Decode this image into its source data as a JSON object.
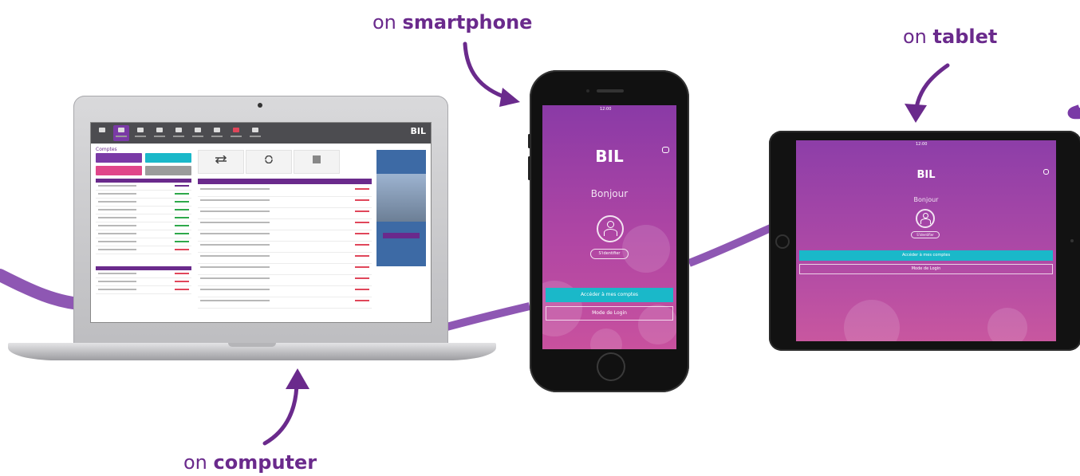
{
  "labels": {
    "smartphone": {
      "prefix": "on",
      "bold": "smartphone"
    },
    "tablet": {
      "prefix": "on",
      "bold": "tablet"
    },
    "computer": {
      "prefix": "on",
      "bold": "computer"
    }
  },
  "brand": {
    "logo": "BIL",
    "purple": "#6a2a8c",
    "turquoise": "#1ab8c9"
  },
  "desktop_app": {
    "page_title": "Comptes",
    "menu_icons": [
      "home-icon",
      "accounts-icon",
      "transfer-icon",
      "cards-icon",
      "invest-icon",
      "savings-icon",
      "documents-icon",
      "mail-icon",
      "settings-icon"
    ],
    "quick_actions": [
      "transfer-icon",
      "refresh-icon",
      "statement-icon"
    ]
  },
  "phone_app": {
    "status_time": "12:00",
    "greeting": "Bonjour",
    "identify_label": "S'identifier",
    "primary_action": "Accéder à mes comptes",
    "secondary_action": "Mode de Login"
  },
  "tablet_app": {
    "status_time": "12:00",
    "greeting": "Bonjour",
    "identify_label": "S'identifier",
    "primary_action": "Accéder à mes comptes",
    "secondary_action": "Mode de Login"
  }
}
